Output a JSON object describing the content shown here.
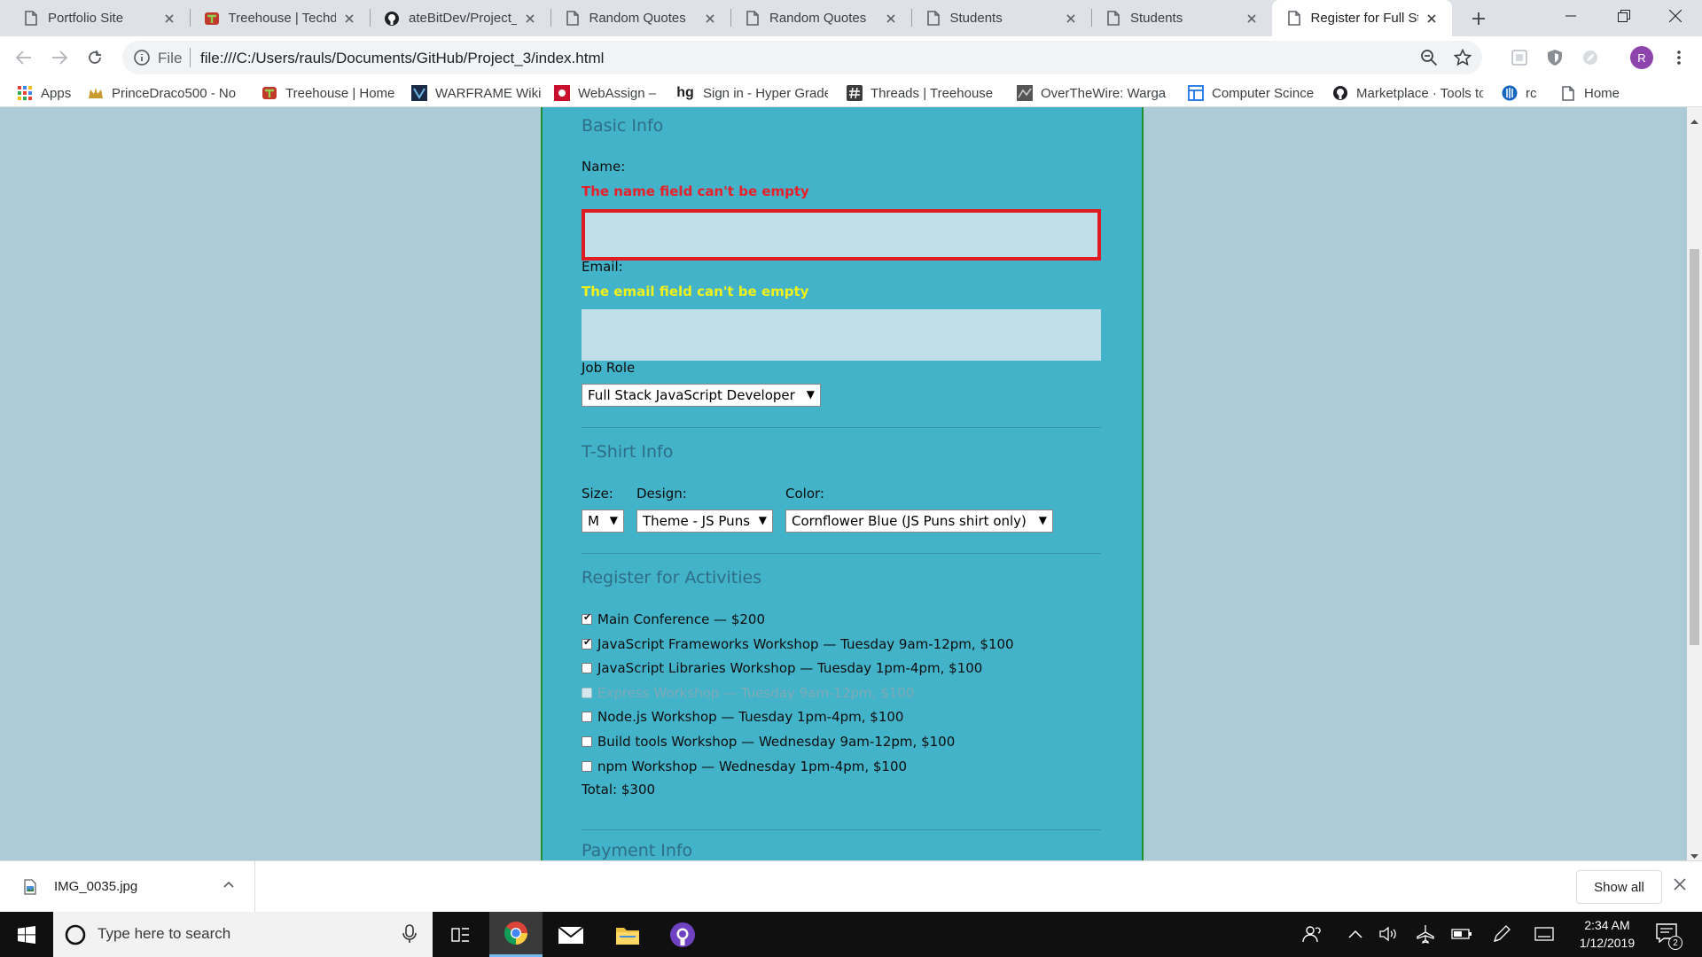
{
  "browser": {
    "tabs": [
      {
        "title": "Portfolio Site",
        "icon": "page-icon"
      },
      {
        "title": "Treehouse | Techde",
        "icon": "treehouse-icon"
      },
      {
        "title": "ateBitDev/Project_",
        "icon": "github-icon"
      },
      {
        "title": "Random Quotes",
        "icon": "page-icon"
      },
      {
        "title": "Random Quotes",
        "icon": "page-icon"
      },
      {
        "title": "Students",
        "icon": "page-icon"
      },
      {
        "title": "Students",
        "icon": "page-icon"
      },
      {
        "title": "Register for Full St",
        "icon": "page-icon",
        "active": true
      }
    ],
    "toolbar": {
      "url_scheme": "File",
      "url": "file:///C:/Users/rauls/Documents/GitHub/Project_3/index.html",
      "avatar_letter": "R"
    },
    "bookmarks": [
      {
        "label": "Apps",
        "icon": "apps-grid-icon"
      },
      {
        "label": "PrinceDraco500 - No",
        "icon": "crown-icon"
      },
      {
        "label": "Treehouse | Home",
        "icon": "treehouse-icon"
      },
      {
        "label": "WARFRAME Wiki",
        "icon": "warframe-icon"
      },
      {
        "label": "WebAssign –",
        "icon": "webassign-icon"
      },
      {
        "label": "Sign in - Hyper Grade",
        "icon": "hg-icon"
      },
      {
        "label": "Threads | Treehouse F",
        "icon": "hash-icon"
      },
      {
        "label": "OverTheWire: Warga",
        "icon": "overthewire-icon"
      },
      {
        "label": "Computer Scince",
        "icon": "layout-icon"
      },
      {
        "label": "Marketplace · Tools to",
        "icon": "github-icon"
      },
      {
        "label": "rc",
        "icon": "rc-icon"
      },
      {
        "label": "Home",
        "icon": "page-icon"
      }
    ]
  },
  "form": {
    "basic_info_legend": "Basic Info",
    "name_label": "Name:",
    "name_error": "The name field can't be empty",
    "name_value": "",
    "email_label": "Email:",
    "email_error": "The email field can't be empty",
    "email_value": "",
    "job_role_label": "Job Role",
    "job_role_selected": "Full Stack JavaScript Developer",
    "tshirt_legend": "T-Shirt Info",
    "size_label": "Size:",
    "size_selected": "M",
    "design_label": "Design:",
    "design_selected": "Theme - JS Puns",
    "color_label": "Color:",
    "color_selected": "Cornflower Blue (JS Puns shirt only)",
    "activities_legend": "Register for Activities",
    "activities": [
      {
        "label": "Main Conference — $200",
        "checked": true,
        "disabled": false
      },
      {
        "label": "JavaScript Frameworks Workshop — Tuesday 9am-12pm, $100",
        "checked": true,
        "disabled": false
      },
      {
        "label": "JavaScript Libraries Workshop — Tuesday 1pm-4pm, $100",
        "checked": false,
        "disabled": false
      },
      {
        "label": "Express Workshop — Tuesday 9am-12pm, $100",
        "checked": false,
        "disabled": true
      },
      {
        "label": "Node.js Workshop — Tuesday 1pm-4pm, $100",
        "checked": false,
        "disabled": false
      },
      {
        "label": "Build tools Workshop — Wednesday 9am-12pm, $100",
        "checked": false,
        "disabled": false
      },
      {
        "label": "npm Workshop — Wednesday 1pm-4pm, $100",
        "checked": false,
        "disabled": false
      }
    ],
    "total": "Total: $300",
    "payment_legend": "Payment Info"
  },
  "colors": {
    "page_background": "#adcbd7",
    "form_background": "#43b3c9",
    "form_border": "#1f8f2e",
    "legend_text": "#2e6e86",
    "name_error": "#e8202a",
    "email_error": "#f2f21a",
    "invalid_border": "#e01b22",
    "field_background": "#c1dfe9"
  },
  "downloads": {
    "file_name": "IMG_0035.jpg",
    "show_all_label": "Show all"
  },
  "taskbar": {
    "search_placeholder": "Type here to search",
    "apps": [
      "task-view-icon",
      "chrome-icon",
      "mail-icon",
      "file-explorer-icon",
      "github-desktop-icon"
    ],
    "time": "2:34 AM",
    "date": "1/12/2019",
    "notification_count": "2"
  }
}
